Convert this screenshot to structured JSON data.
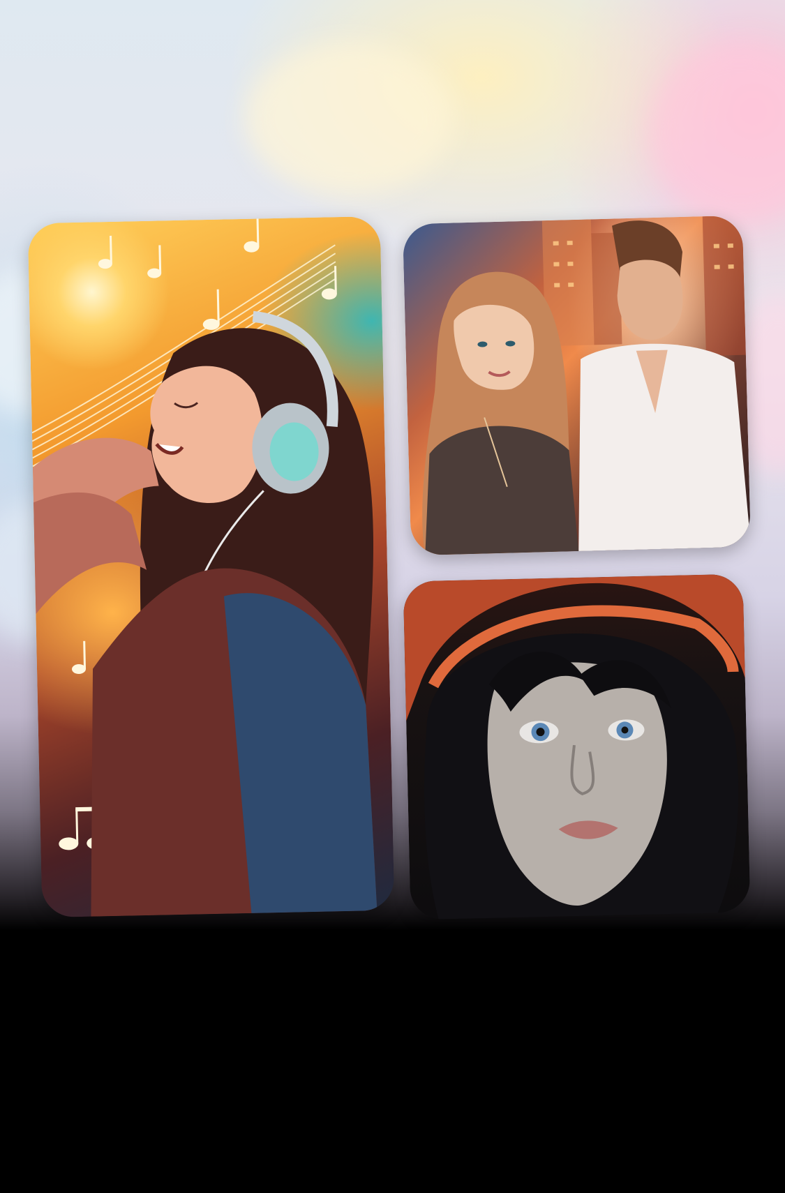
{
  "screen": {
    "background": "promo-collage",
    "colors": {
      "sky_light": "#dfe9f1",
      "sky_warm": "#fff0be",
      "sky_pink": "#ffbed2",
      "bottom": "#000000"
    }
  },
  "cards": [
    {
      "name": "music-girl-cover",
      "subject": "girl-with-headphones-and-music-notes"
    },
    {
      "name": "couple-cover",
      "subject": "woman-and-man-city-sunset"
    },
    {
      "name": "hooded-girl-cover",
      "subject": "girl-in-red-hood"
    }
  ]
}
